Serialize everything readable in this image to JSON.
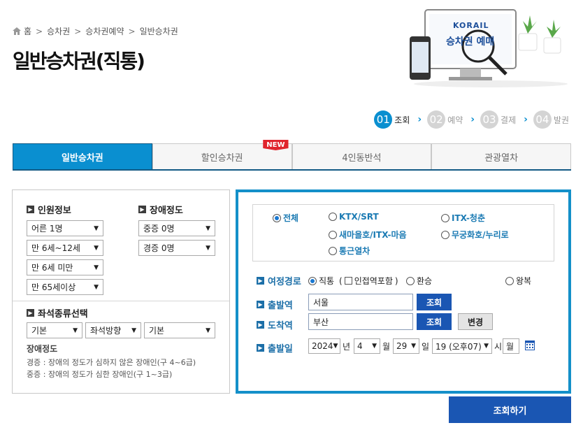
{
  "breadcrumb": {
    "items": [
      "홈",
      "승차권",
      "승차권예약",
      "일반승차권"
    ]
  },
  "page_title": "일반승차권(직통)",
  "promo": {
    "brand": "KORAIL",
    "caption": "승차권 예매"
  },
  "steps": [
    {
      "num": "01",
      "label": "조회"
    },
    {
      "num": "02",
      "label": "예약"
    },
    {
      "num": "03",
      "label": "결제"
    },
    {
      "num": "04",
      "label": "발권"
    }
  ],
  "tabs": [
    {
      "label": "일반승차권"
    },
    {
      "label": "할인승차권",
      "badge": "NEW"
    },
    {
      "label": "4인동반석"
    },
    {
      "label": "관광열차"
    }
  ],
  "left": {
    "passenger_header": "인원정보",
    "disability_header": "장애정도",
    "passengers": [
      "어른 1명",
      "만 6세~12세",
      "만 6세 미만",
      "만 65세이상"
    ],
    "disability": [
      "중증 0명",
      "경증 0명"
    ],
    "seat_header": "좌석종류선택",
    "seat_selects": [
      "기본",
      "좌석방향",
      "기본"
    ],
    "note_title": "장애정도",
    "note_lines": [
      "경증 : 장애의 정도가 심하지 않은 장애인(구 4~6급)",
      "중증 : 장애의 정도가 심한 장애인(구 1~3급)"
    ]
  },
  "right": {
    "train_types": [
      "전체",
      "KTX/SRT",
      "ITX-청춘",
      "새마을호/ITX-마음",
      "무궁화호/누리로",
      "통근열차"
    ],
    "route_label": "여정경로",
    "route_direct": "직통",
    "route_nearby": "인접역포함",
    "route_transfer": "환승",
    "route_round": "왕복",
    "depart_label": "출발역",
    "depart_value": "서울",
    "arrive_label": "도착역",
    "arrive_value": "부산",
    "lookup_button": "조회",
    "change_button": "변경",
    "date_label": "출발일",
    "year": "2024",
    "year_unit": "년",
    "month": "4",
    "month_unit": "월",
    "day": "29",
    "day_unit": "일",
    "hour": "19 (오후07)",
    "hour_unit": "시",
    "weekday": "월"
  },
  "search_button": "조회하기",
  "colors": {
    "accent": "#0a8fd0",
    "panel_border": "#1490c9",
    "button": "#1a56b3"
  }
}
